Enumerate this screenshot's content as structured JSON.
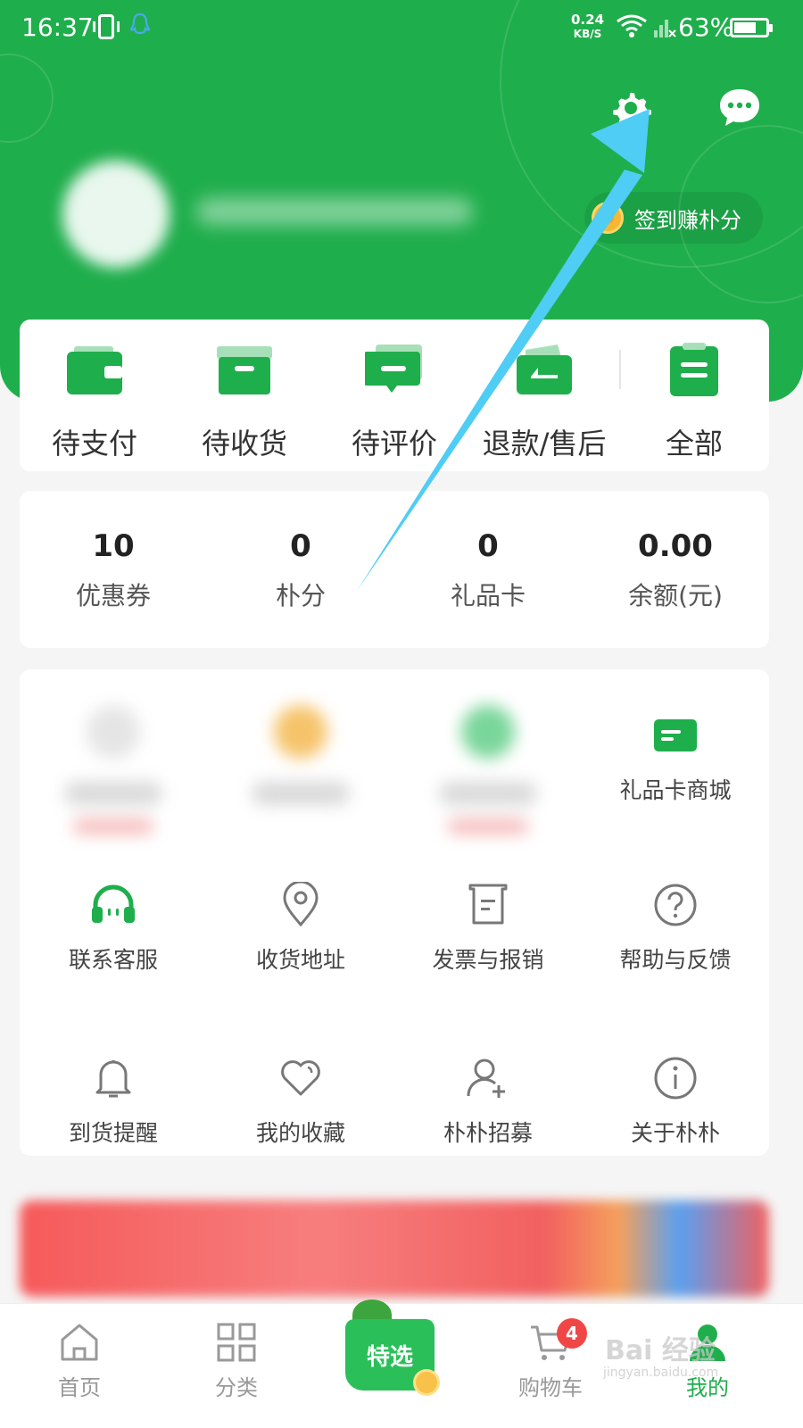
{
  "status_bar": {
    "time": "16:37",
    "speed_value": "0.24",
    "speed_unit": "KB/S",
    "battery": "63%",
    "icons": [
      "vibrate-icon",
      "qq-icon",
      "wifi-icon",
      "signal-icon",
      "battery-icon"
    ]
  },
  "header": {
    "settings_icon": "gear-icon",
    "message_icon": "chat-bubble-icon",
    "signin_label": "签到赚朴分",
    "accent": "#1fae4c"
  },
  "orders": {
    "items": [
      {
        "label": "待支付",
        "icon": "wallet-icon"
      },
      {
        "label": "待收货",
        "icon": "box-icon"
      },
      {
        "label": "待评价",
        "icon": "comment-icon"
      },
      {
        "label": "退款/售后",
        "icon": "refund-icon"
      },
      {
        "label": "全部",
        "icon": "clipboard-icon"
      }
    ]
  },
  "assets": {
    "items": [
      {
        "value": "10",
        "label": "优惠券"
      },
      {
        "value": "0",
        "label": "朴分"
      },
      {
        "value": "0",
        "label": "礼品卡"
      },
      {
        "value": "0.00",
        "label": "余额(元)"
      }
    ]
  },
  "services": {
    "gift_card_mall": {
      "label": "礼品卡商城",
      "icon": "gift-card-icon"
    },
    "items": [
      {
        "label": "联系客服",
        "icon": "headset-icon"
      },
      {
        "label": "收货地址",
        "icon": "location-pin-icon"
      },
      {
        "label": "发票与报销",
        "icon": "invoice-icon"
      },
      {
        "label": "帮助与反馈",
        "icon": "help-icon"
      },
      {
        "label": "到货提醒",
        "icon": "bell-icon"
      },
      {
        "label": "我的收藏",
        "icon": "heart-icon"
      },
      {
        "label": "朴朴招募",
        "icon": "add-user-icon"
      },
      {
        "label": "关于朴朴",
        "icon": "info-icon"
      }
    ]
  },
  "tabbar": {
    "home": "首页",
    "category": "分类",
    "featured": "特选",
    "cart": "购物车",
    "cart_badge": "4",
    "mine": "我的"
  },
  "watermark": {
    "text": "Bai 经验",
    "sub": "jingyan.baidu.com"
  }
}
